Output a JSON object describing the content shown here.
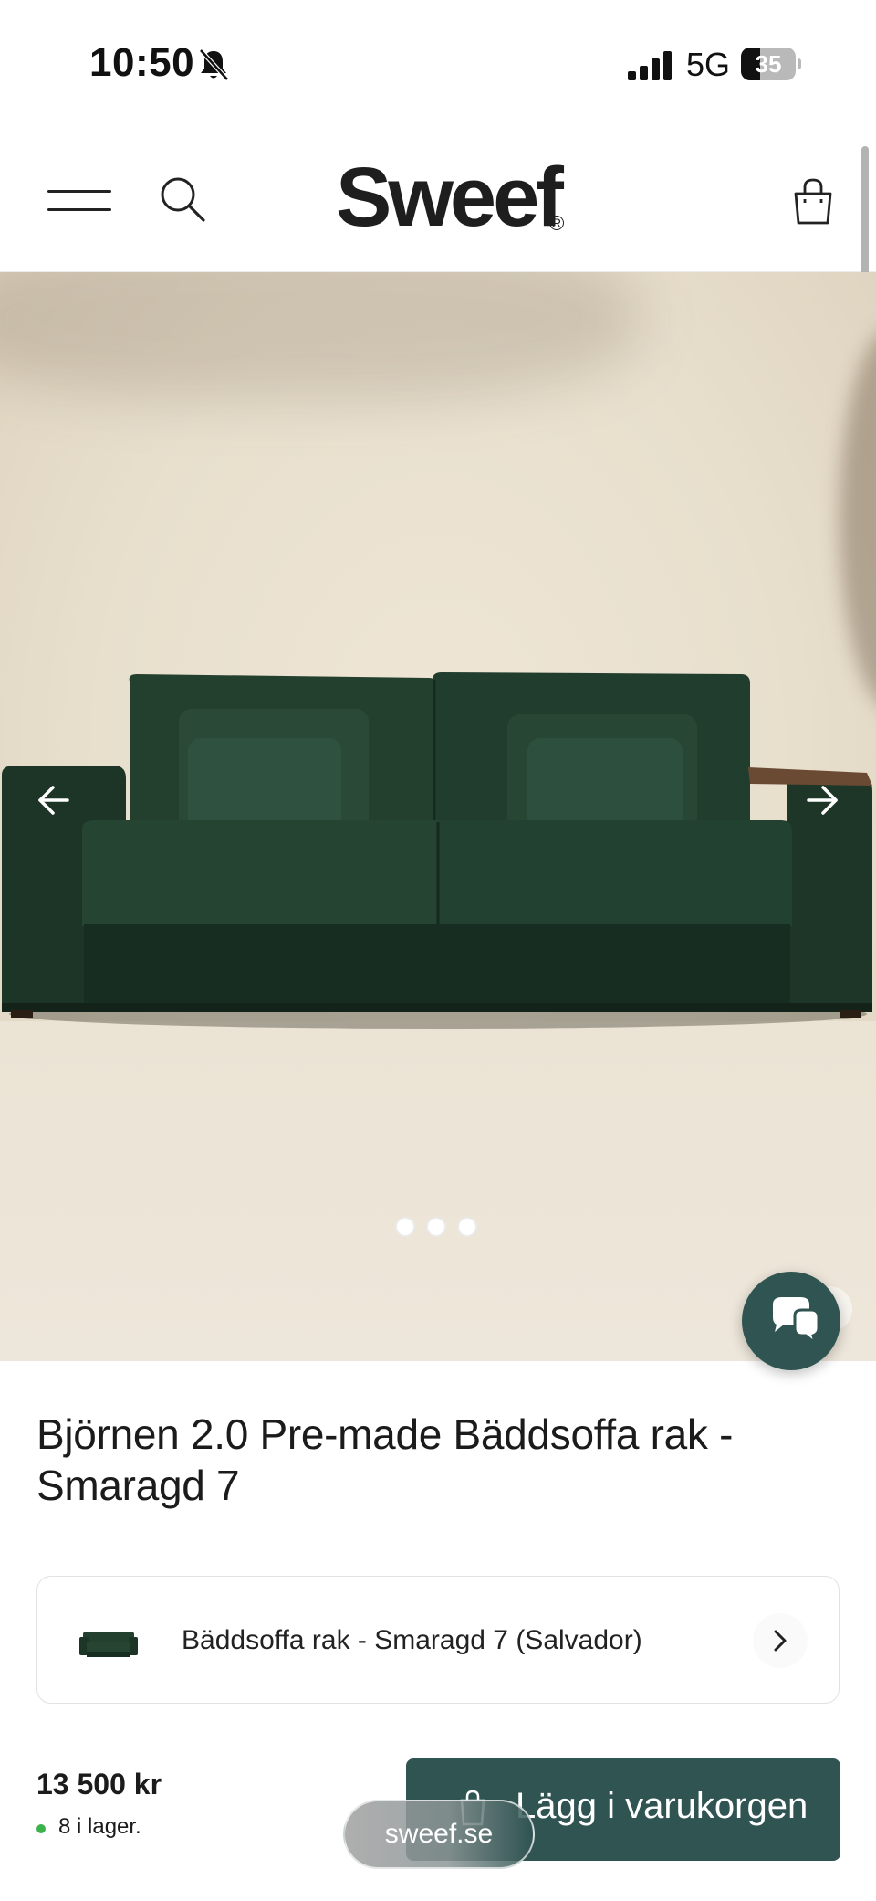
{
  "status_bar": {
    "time": "10:50",
    "network": "5G",
    "battery_level": "35",
    "battery_fraction": 0.35
  },
  "header": {
    "logo": "Sweef",
    "logo_mark": "R",
    "icons": [
      "menu-icon",
      "search-icon",
      "shopping-bag-icon"
    ]
  },
  "gallery": {
    "image_count": 3,
    "active_index": 0,
    "icons": [
      "arrow-left-icon",
      "arrow-right-icon"
    ]
  },
  "chat": {
    "icon": "chat-bubbles-icon"
  },
  "product": {
    "title": "Björnen 2.0 Pre-made Bäddsoffa rak - Smaragd 7",
    "variant_label": "Bäddsoffa rak - Smaragd 7 (Salvador)",
    "price": "13 500 kr",
    "stock": "8 i lager.",
    "stock_color": "#3bb34a"
  },
  "cta": {
    "add_to_cart": "Lägg i varukorgen",
    "color": "#2f5452"
  },
  "browser": {
    "url": "sweef.se"
  },
  "colors": {
    "accent": "#2f5452",
    "sofa": "#1f3a2b"
  }
}
